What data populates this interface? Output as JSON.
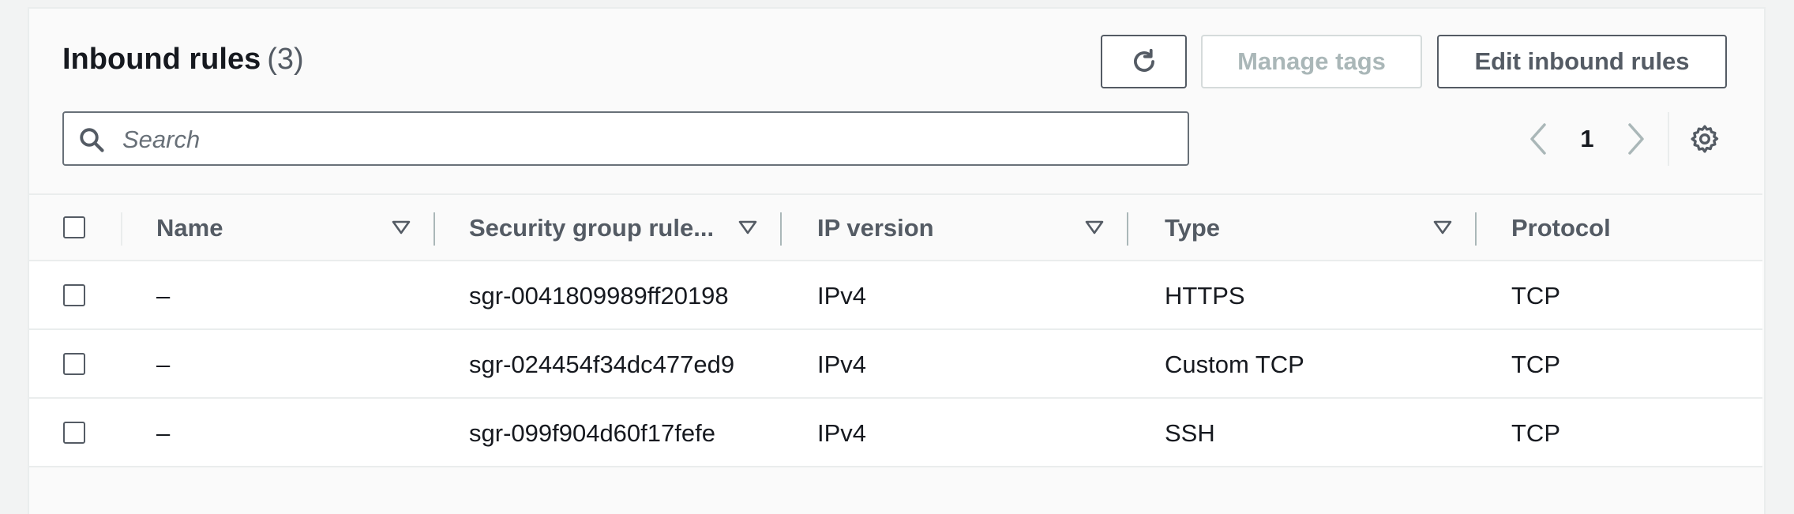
{
  "header": {
    "title": "Inbound rules",
    "count": "(3)"
  },
  "toolbar": {
    "refresh_icon": "refresh-icon",
    "manage_tags_label": "Manage tags",
    "edit_label": "Edit inbound rules"
  },
  "search": {
    "placeholder": "Search",
    "value": ""
  },
  "pagination": {
    "current_page": "1"
  },
  "table": {
    "columns": [
      "Name",
      "Security group rule...",
      "IP version",
      "Type",
      "Protocol"
    ],
    "rows": [
      {
        "name": "–",
        "rule_id": "sgr-0041809989ff20198",
        "ip_version": "IPv4",
        "type": "HTTPS",
        "protocol": "TCP"
      },
      {
        "name": "–",
        "rule_id": "sgr-024454f34dc477ed9",
        "ip_version": "IPv4",
        "type": "Custom TCP",
        "protocol": "TCP"
      },
      {
        "name": "–",
        "rule_id": "sgr-099f904d60f17fefe",
        "ip_version": "IPv4",
        "type": "SSH",
        "protocol": "TCP"
      }
    ]
  },
  "colors": {
    "text": "#16191f",
    "secondary_text": "#545b64",
    "disabled_text": "#aab7b8",
    "border": "#eaeded"
  }
}
